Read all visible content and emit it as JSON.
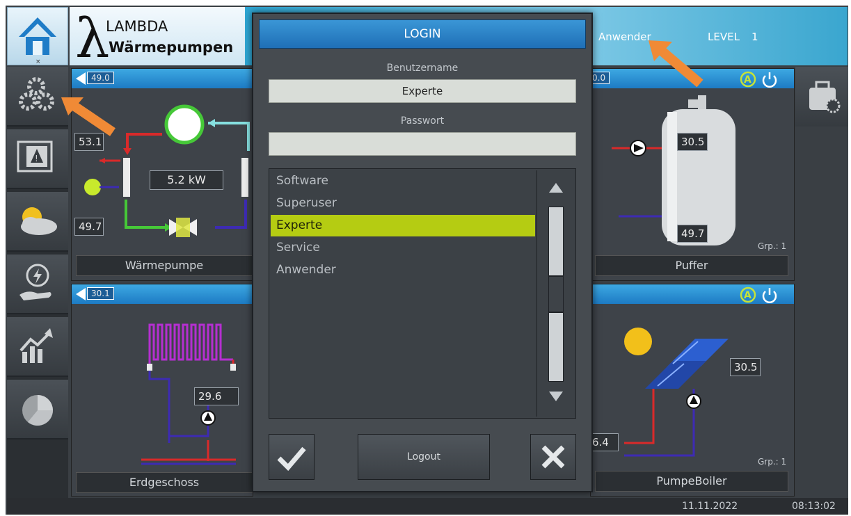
{
  "header": {
    "logo_line1": "LAMBDA",
    "logo_line2": "Wärmepumpen",
    "user_label": "Anwender",
    "level_label": "LEVEL",
    "level_value": "1"
  },
  "panels": {
    "heatpump": {
      "bar_value": "49.0",
      "temp_in": "53.1",
      "power": "5.2 kW",
      "temp_out": "49.7",
      "label": "Wärmepumpe"
    },
    "buffer": {
      "bar_value": "0.0",
      "temp_top": "30.5",
      "temp_bottom": "49.7",
      "group": "Grp.: 1",
      "label": "Puffer"
    },
    "floor": {
      "bar_value": "30.1",
      "temp": "29.6",
      "label": "Erdgeschoss"
    },
    "solar": {
      "temp_panel": "30.5",
      "temp_return": "6.4",
      "group": "Grp.: 1",
      "label": "PumpeBoiler"
    }
  },
  "dialog": {
    "title": "LOGIN",
    "username_label": "Benutzername",
    "username_value": "Experte",
    "password_label": "Passwort",
    "password_value": "",
    "users": [
      {
        "name": "Software"
      },
      {
        "name": "Superuser"
      },
      {
        "name": "Experte"
      },
      {
        "name": "Service"
      },
      {
        "name": "Anwender"
      }
    ],
    "selected_index": 2,
    "logout_label": "Logout"
  },
  "status": {
    "date": "11.11.2022",
    "time": "08:13:02"
  },
  "colors": {
    "accent_blue": "#1f7cc7",
    "selection_green": "#b5cc12",
    "arrow_orange": "#f08a36"
  }
}
